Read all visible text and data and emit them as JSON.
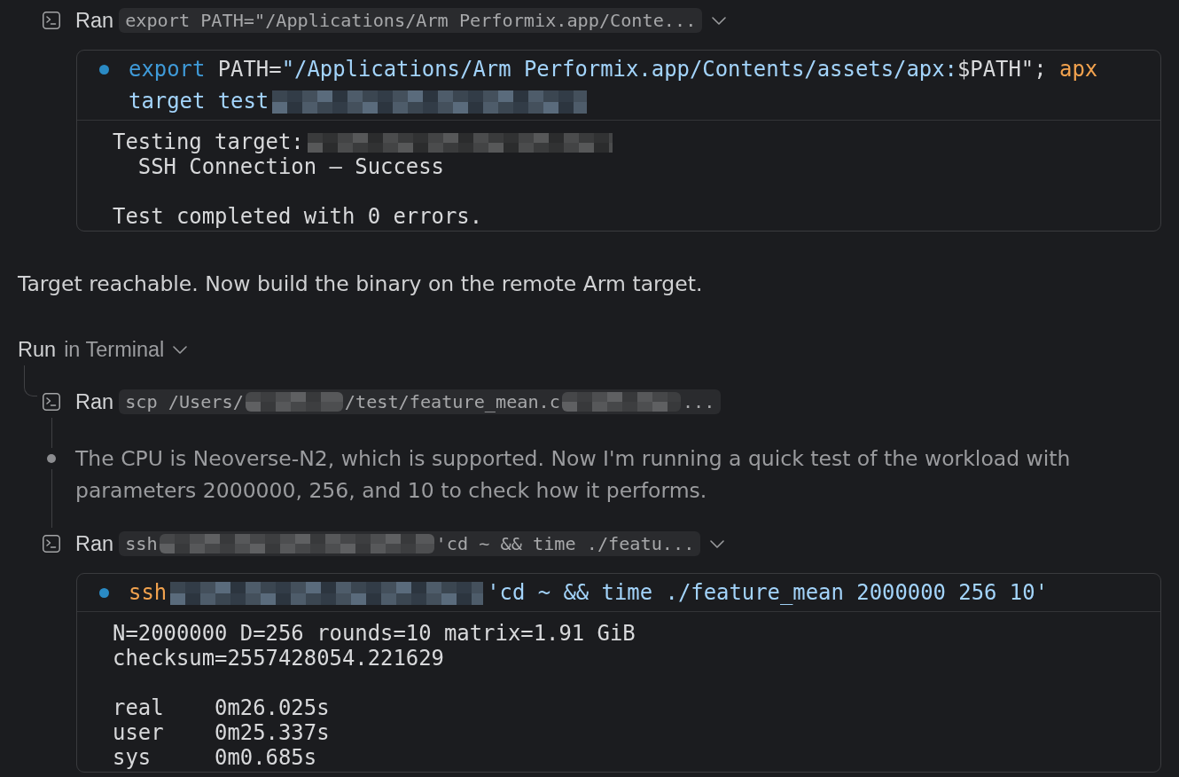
{
  "items": [
    {
      "kind": "run",
      "label": "Ran",
      "preview": [
        {
          "kind": "plain",
          "text": "export PATH=\"/Applications/Arm Performix.app/Conte..."
        }
      ],
      "expanded": true,
      "terminal": {
        "command_lines": [
          {
            "segments": [
              {
                "kind": "keyword",
                "text": "export"
              },
              {
                "kind": "plain",
                "text": " PATH="
              },
              {
                "kind": "string",
                "text": "\"/Applications/Arm Performix.app/Contents/assets/apx:"
              },
              {
                "kind": "plain",
                "text": "$PATH\"; "
              },
              {
                "kind": "command",
                "text": "apx"
              }
            ]
          },
          {
            "segments": [
              {
                "kind": "argument",
                "text": "target test"
              },
              {
                "kind": "redacted"
              }
            ]
          }
        ],
        "output_lines": [
          {
            "kind": "text",
            "segments": [
              {
                "kind": "plain",
                "text": "Testing target:"
              },
              {
                "kind": "redacted"
              }
            ]
          },
          {
            "kind": "text",
            "segments": [
              {
                "kind": "plain",
                "text": "  SSH Connection – Success"
              }
            ]
          },
          {
            "kind": "blank"
          },
          {
            "kind": "text",
            "segments": [
              {
                "kind": "plain",
                "text": "Test completed with 0 errors."
              }
            ]
          }
        ]
      }
    },
    {
      "kind": "message",
      "text": "Target reachable. Now build the binary on the remote Arm target."
    },
    {
      "kind": "group",
      "action": "Run",
      "target": "in Terminal",
      "expanded": true,
      "children": [
        {
          "kind": "run",
          "label": "Ran",
          "preview": [
            {
              "kind": "plain",
              "text": "scp /Users/"
            },
            {
              "kind": "redacted"
            },
            {
              "kind": "plain",
              "text": "/test/feature_mean.c"
            },
            {
              "kind": "redacted"
            },
            {
              "kind": "plain",
              "text": "..."
            }
          ],
          "expanded": false
        },
        {
          "kind": "thought",
          "text": "The CPU is Neoverse-N2, which is supported. Now I'm running a quick test of the workload with parameters 2000000, 256, and 10 to check how it performs."
        },
        {
          "kind": "run",
          "label": "Ran",
          "preview": [
            {
              "kind": "plain",
              "text": "ssh"
            },
            {
              "kind": "redacted"
            },
            {
              "kind": "plain",
              "text": "'cd ~ && time ./featu..."
            }
          ],
          "expanded": true,
          "terminal": {
            "command_lines": [
              {
                "segments": [
                  {
                    "kind": "command",
                    "text": "ssh"
                  },
                  {
                    "kind": "redacted"
                  },
                  {
                    "kind": "string",
                    "text": "'cd ~ && time ./feature_mean 2000000 256 10'"
                  }
                ]
              }
            ],
            "output_lines": [
              {
                "kind": "text",
                "segments": [
                  {
                    "kind": "plain",
                    "text": "N=2000000 D=256 rounds=10 matrix=1.91 GiB"
                  }
                ]
              },
              {
                "kind": "text",
                "segments": [
                  {
                    "kind": "plain",
                    "text": "checksum=2557428054.221629"
                  }
                ]
              },
              {
                "kind": "blank"
              },
              {
                "kind": "text",
                "segments": [
                  {
                    "kind": "plain",
                    "text": "real    0m26.025s"
                  }
                ]
              },
              {
                "kind": "text",
                "segments": [
                  {
                    "kind": "plain",
                    "text": "user    0m25.337s"
                  }
                ]
              },
              {
                "kind": "text",
                "segments": [
                  {
                    "kind": "plain",
                    "text": "sys     0m0.685s"
                  }
                ]
              }
            ]
          }
        }
      ]
    }
  ]
}
